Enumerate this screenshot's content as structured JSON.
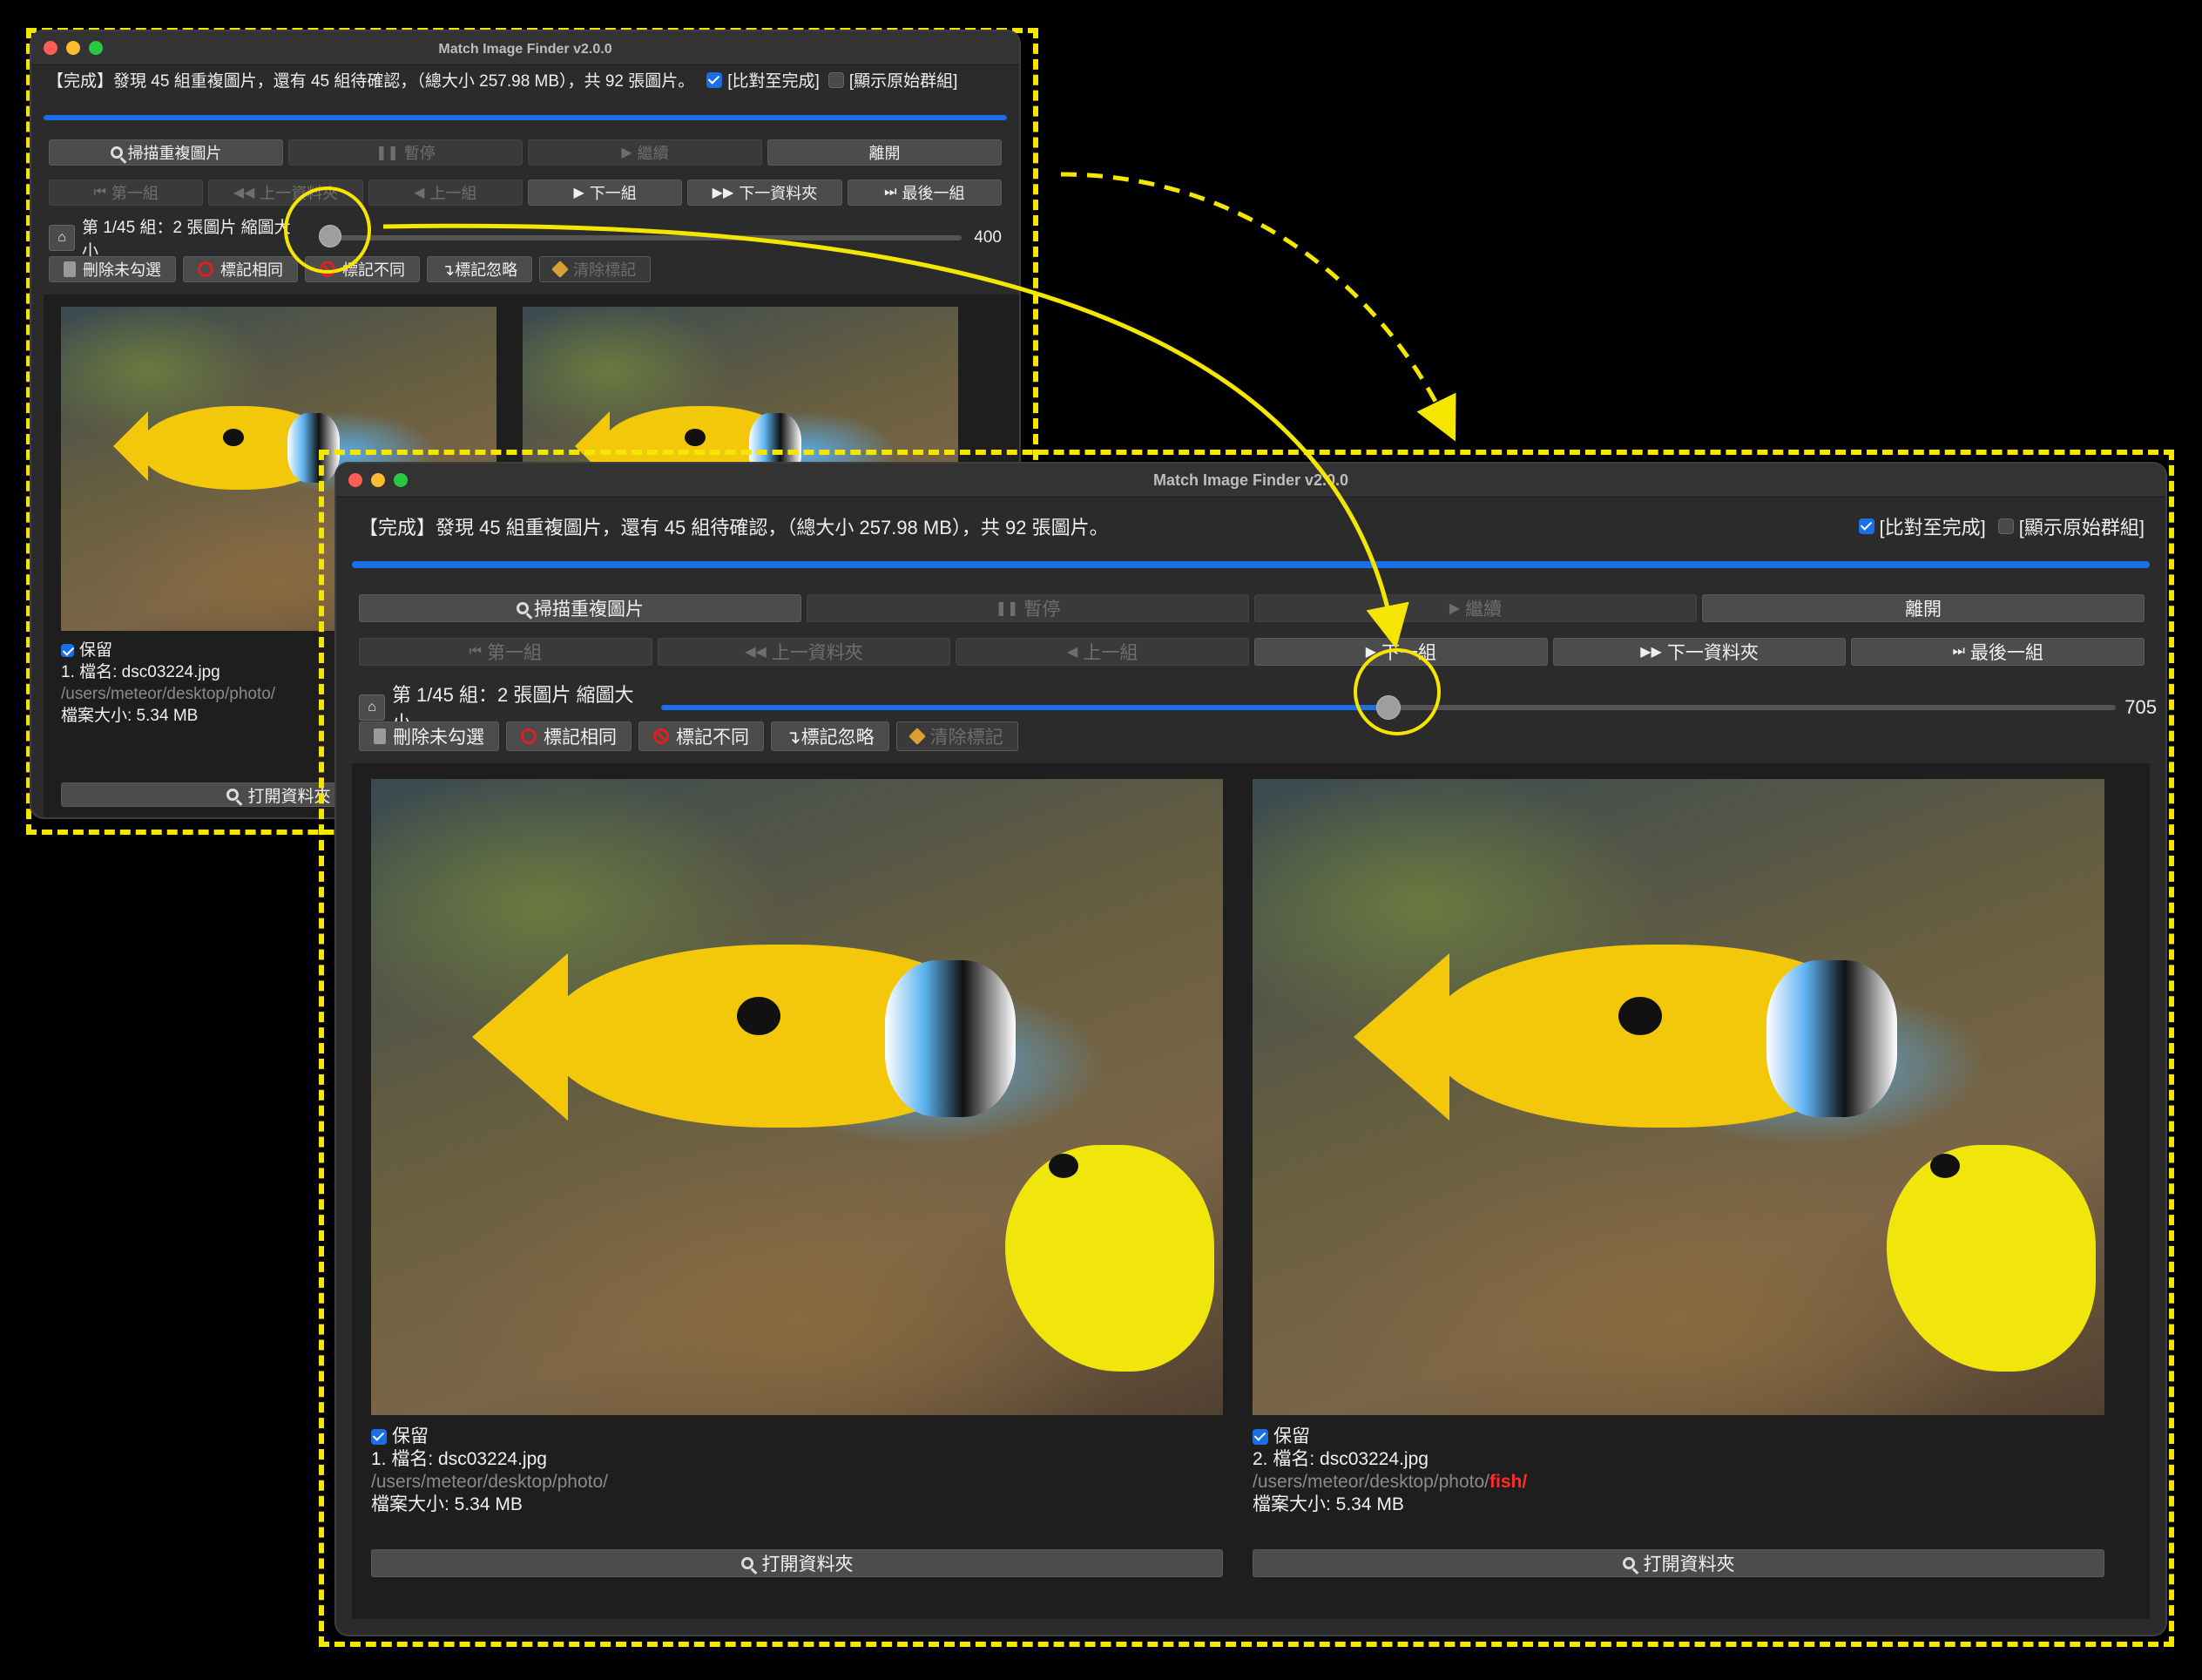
{
  "app": {
    "title": "Match Image Finder v2.0.0"
  },
  "status": {
    "message": "【完成】發現 45 組重複圖片，還有 45 組待確認，（總大小 257.98 MB），共 92 張圖片。",
    "compare_to_complete": "[比對至完成]",
    "show_original_groups": "[顯示原始群組]"
  },
  "progress_fraction": 1.0,
  "toolbar_row1": {
    "scan": "掃描重複圖片",
    "pause": "暫停",
    "resume": "繼續",
    "leave": "離開"
  },
  "toolbar_row2": {
    "first_group": "第一組",
    "prev_folder": "上一資料夾",
    "prev_group": "上一組",
    "next_group": "下一組",
    "next_folder": "下一資料夾",
    "last_group": "最後一組"
  },
  "group_info": "第 1/45 組：2 張圖片 縮圖大小",
  "thumb_size": {
    "before": "400",
    "after": "705",
    "after_fraction": 0.5
  },
  "actions": {
    "delete_unchecked": "刪除未勾選",
    "mark_same": "標記相同",
    "mark_different": "標記不同",
    "mark_ignore": "↴標記忽略",
    "clear_marks": "清除標記"
  },
  "images": [
    {
      "keep_label": "保留",
      "name": "1. 檔名: dsc03224.jpg",
      "path": "/users/meteor/desktop/photo/",
      "path_highlight": "",
      "size": "檔案大小: 5.34 MB",
      "open_folder": "打開資料夾"
    },
    {
      "keep_label": "保留",
      "name": "2. 檔名: dsc03224.jpg",
      "path": "/users/meteor/desktop/photo/",
      "path_highlight": "fish/",
      "size": "檔案大小: 5.34 MB",
      "open_folder": "打開資料夾"
    }
  ],
  "small_window": {
    "status_message": "【完成】發現 45 組重複圖片，還有 45 組待確認，（總大小 257.98 MB），共 92 張圖片。",
    "open_folder_partial": "打開資料夾"
  },
  "colors": {
    "annotation": "#f5e600",
    "accent": "#1a6fe8",
    "path_highlight": "#ff2a2a"
  }
}
